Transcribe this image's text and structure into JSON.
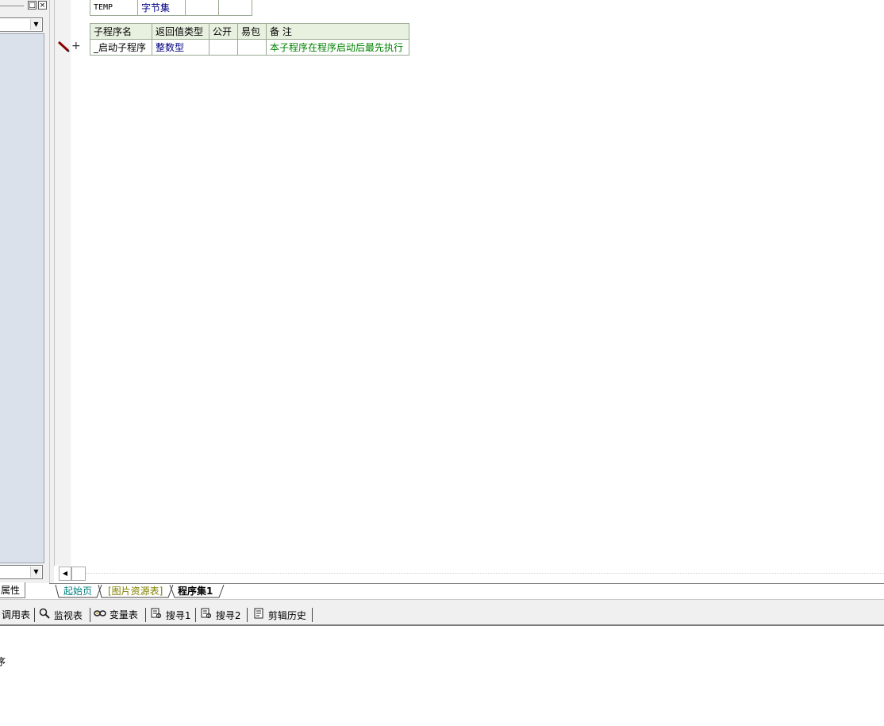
{
  "left_panel": {
    "titlebar": {
      "restore_glyph": "□",
      "close_glyph": "×"
    },
    "bottom_tab_label": "属性"
  },
  "data_table": {
    "rows": [
      {
        "name": "TEMP",
        "type": "字节集",
        "c3": "",
        "c4": ""
      }
    ]
  },
  "sub_table": {
    "headers": [
      "子程序名",
      "返回值类型",
      "公开",
      "易包",
      "备 注"
    ],
    "rows": [
      {
        "name": "_启动子程序",
        "return_type": "整数型",
        "public": "",
        "easy_pkg": "",
        "note": "本子程序在程序启动后最先执行"
      }
    ]
  },
  "editor": {
    "plus_glyph": "+"
  },
  "doc_tabs": [
    {
      "label": "起始页"
    },
    {
      "label": "[图片资源表]"
    },
    {
      "label": "程序集1"
    }
  ],
  "bottom_tabs": [
    {
      "label": "调用表",
      "icon": "call-table-icon"
    },
    {
      "label": "监视表",
      "icon": "magnifier-icon"
    },
    {
      "label": "变量表",
      "icon": "variable-icon"
    },
    {
      "label": "搜寻1",
      "icon": "search-doc-icon"
    },
    {
      "label": "搜寻2",
      "icon": "search-doc-icon"
    },
    {
      "label": "剪辑历史",
      "icon": "clipboard-icon"
    }
  ],
  "output": {
    "text": "序"
  },
  "colors": {
    "type_blue": "#000080",
    "note_green": "#008000",
    "tab_start_cyan": "#008080",
    "tab_resource_olive": "#808000",
    "left_list_bg": "#dbe1ea",
    "table_header_bg": "#e8f0e0"
  }
}
